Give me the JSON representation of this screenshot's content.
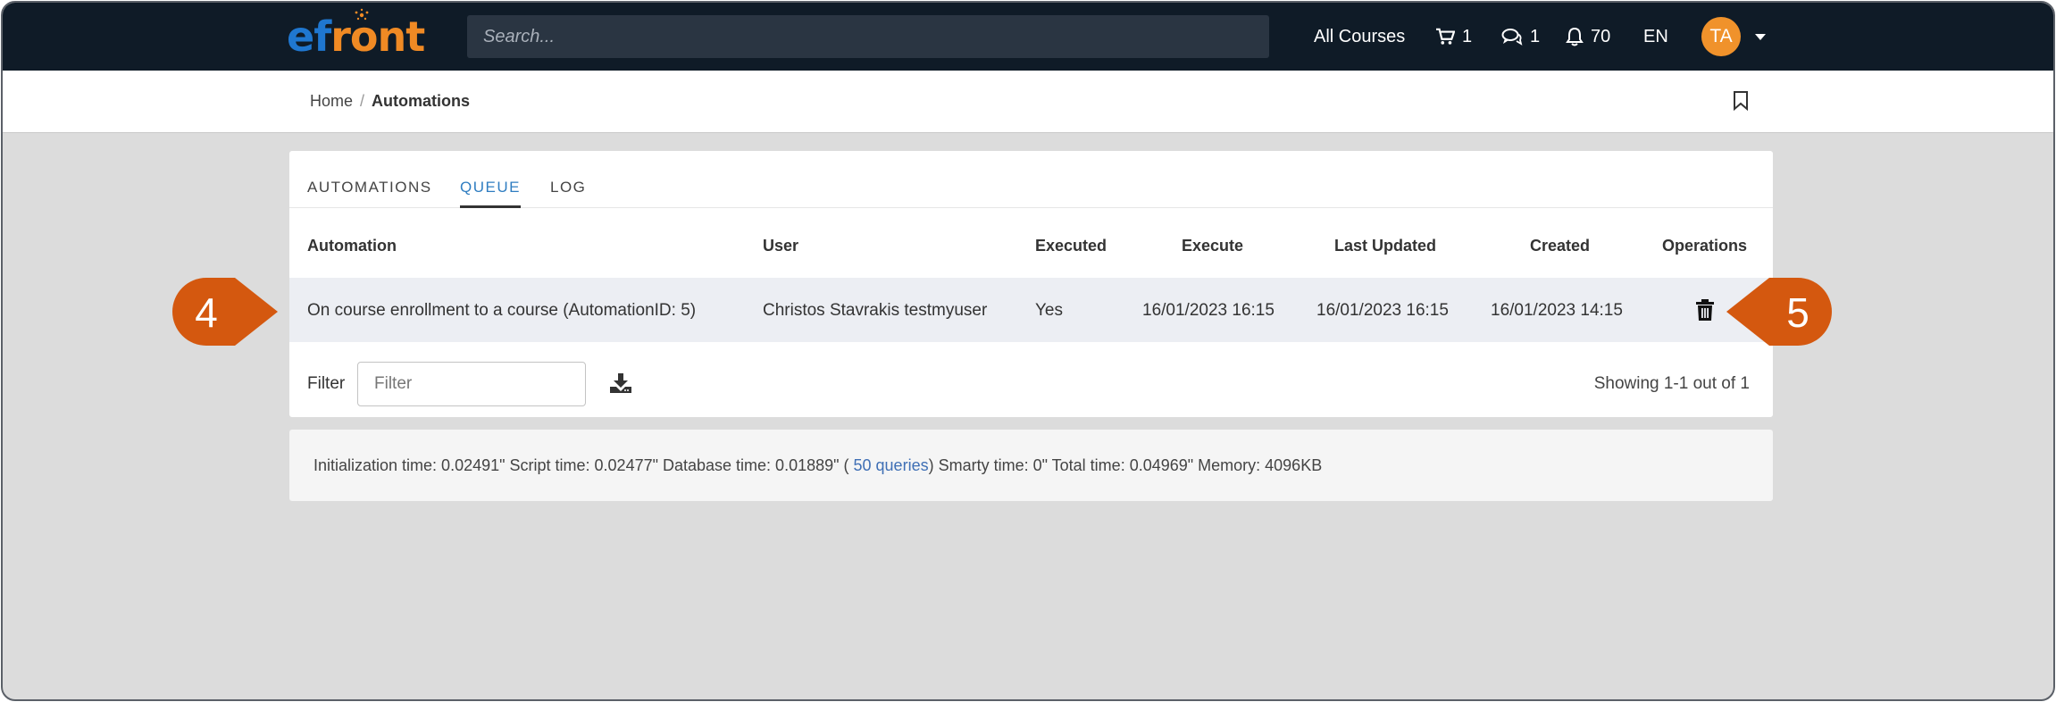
{
  "navbar": {
    "logo_part1": "ef",
    "logo_part2": "ront",
    "logo_o": "o",
    "search_placeholder": "Search...",
    "all_courses": "All Courses",
    "cart_count": "1",
    "messages_count": "1",
    "notifications_count": "70",
    "language": "EN",
    "avatar_initials": "TA"
  },
  "breadcrumb": {
    "home": "Home",
    "separator": "/",
    "current": "Automations"
  },
  "tabs": [
    {
      "label": "AUTOMATIONS",
      "active": false
    },
    {
      "label": "QUEUE",
      "active": true
    },
    {
      "label": "LOG",
      "active": false
    }
  ],
  "table": {
    "columns": [
      "Automation",
      "User",
      "Executed",
      "Execute",
      "Last Updated",
      "Created",
      "Operations"
    ],
    "rows": [
      {
        "automation": "On course enrollment to a course (AutomationID: 5)",
        "user": "Christos Stavrakis testmyuser",
        "executed": "Yes",
        "execute": "16/01/2023 16:15",
        "last_updated": "16/01/2023 16:15",
        "created": "16/01/2023 14:15",
        "operations_icon": "trash-icon"
      }
    ]
  },
  "filter": {
    "label": "Filter",
    "placeholder": "Filter"
  },
  "pagination": {
    "showing": "Showing 1-1 out of 1"
  },
  "stats": {
    "before_link": "Initialization time: 0.02491\" Script time: 0.02477\" Database time: 0.01889\" ( ",
    "link": "50 queries",
    "after_link": ") Smarty time: 0\" Total time: 0.04969\" Memory: 4096KB"
  },
  "callouts": {
    "left": "4",
    "right": "5"
  },
  "colors": {
    "navbar": "#0f1b27",
    "accent_blue": "#2f7dc1",
    "logo_blue": "#1f77d0",
    "logo_orange": "#f08a24",
    "avatar": "#f0922b",
    "callout": "#d4580f",
    "page_bg": "#dcdcdc"
  }
}
